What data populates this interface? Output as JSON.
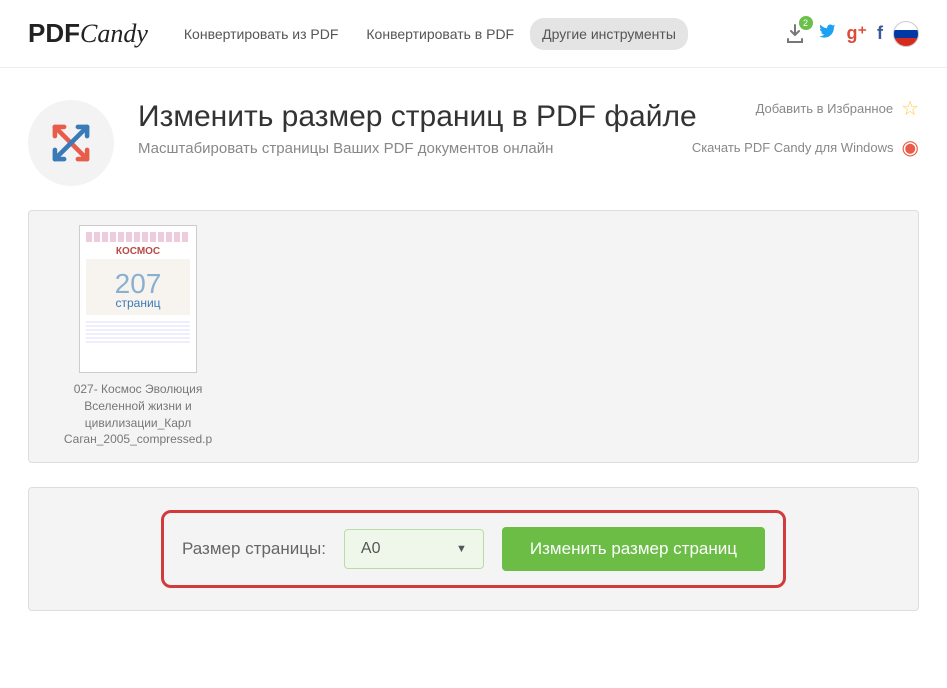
{
  "logo": {
    "left": "PDF",
    "right": "Candy"
  },
  "nav": {
    "convert_from": "Конвертировать из PDF",
    "convert_to": "Конвертировать в PDF",
    "other_tools": "Другие инструменты"
  },
  "header_right": {
    "download_badge": "2"
  },
  "side_actions": {
    "favorite": "Добавить в Избранное",
    "download_app": "Скачать PDF Candy для Windows"
  },
  "page": {
    "title": "Изменить размер страниц в PDF файле",
    "subtitle": "Масштабировать страницы Ваших PDF документов онлайн"
  },
  "thumb": {
    "doc_label": "КОСМОС",
    "page_count_num": "207",
    "page_count_label": "страниц",
    "file_name": "027- Космос Эволюция Вселенной жизни и цивилизации_Карл Саган_2005_compressed.p"
  },
  "controls": {
    "label": "Размер страницы:",
    "select_value": "A0",
    "button": "Изменить размер страниц"
  }
}
